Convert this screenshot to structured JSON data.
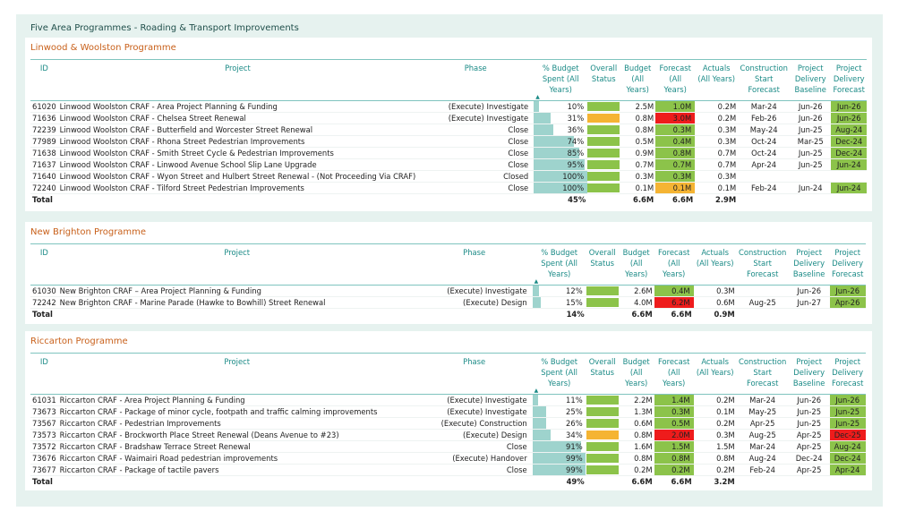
{
  "page_title": "Five Area Programmes - Roading & Transport Improvements",
  "colors": {
    "green": "#8cc34a",
    "amber": "#f5b433",
    "red": "#ee1c1c",
    "header_text": "#1a8a86",
    "section_title": "#c8601a",
    "background": "#e6f2ef"
  },
  "columns": {
    "id": "ID",
    "project": "Project",
    "phase": "Phase",
    "pct_budget": "% Budget Spent (All Years)",
    "overall_status": "Overall Status",
    "budget": "Budget (All Years)",
    "forecast": "Forecast (All Years)",
    "actuals": "Actuals (All Years)",
    "construction_start": "Construction Start Forecast",
    "delivery_baseline": "Project Delivery Baseline",
    "delivery_forecast": "Project Delivery Forecast"
  },
  "sort_icon": "triangle-up",
  "sections": [
    {
      "title": "Linwood & Woolston Programme",
      "rows": [
        {
          "id": "61020",
          "project": "Linwood Woolston CRAF - Area Project Planning & Funding",
          "phase": "(Execute) Investigate",
          "pct": "10%",
          "pct_value": 10,
          "status": "green",
          "budget": "2.5M",
          "forecast": "1.0M",
          "forecast_color": "green",
          "actuals": "0.2M",
          "construction_start": "Mar-24",
          "delivery_baseline": "Jun-26",
          "delivery_forecast": "Jun-26",
          "delivery_color": "green"
        },
        {
          "id": "71636",
          "project": "Linwood Woolston CRAF - Chelsea Street Renewal",
          "phase": "(Execute) Investigate",
          "pct": "31%",
          "pct_value": 31,
          "status": "amber",
          "budget": "0.8M",
          "forecast": "3.0M",
          "forecast_color": "red",
          "actuals": "0.2M",
          "construction_start": "Feb-26",
          "delivery_baseline": "Jun-26",
          "delivery_forecast": "Jun-26",
          "delivery_color": "green"
        },
        {
          "id": "72239",
          "project": "Linwood Woolston CRAF - Butterfield and Worcester Street Renewal",
          "phase": "Close",
          "pct": "36%",
          "pct_value": 36,
          "status": "green",
          "budget": "0.8M",
          "forecast": "0.3M",
          "forecast_color": "green",
          "actuals": "0.3M",
          "construction_start": "May-24",
          "delivery_baseline": "Jun-25",
          "delivery_forecast": "Aug-24",
          "delivery_color": "green"
        },
        {
          "id": "77989",
          "project": "Linwood Woolston CRAF - Rhona Street Pedestrian Improvements",
          "phase": "Close",
          "pct": "74%",
          "pct_value": 74,
          "status": "green",
          "budget": "0.5M",
          "forecast": "0.4M",
          "forecast_color": "green",
          "actuals": "0.3M",
          "construction_start": "Oct-24",
          "delivery_baseline": "Mar-25",
          "delivery_forecast": "Dec-24",
          "delivery_color": "green"
        },
        {
          "id": "71638",
          "project": "Linwood Woolston CRAF - Smith Street Cycle & Pedestrian Improvements",
          "phase": "Close",
          "pct": "85%",
          "pct_value": 85,
          "status": "green",
          "budget": "0.9M",
          "forecast": "0.8M",
          "forecast_color": "green",
          "actuals": "0.7M",
          "construction_start": "Oct-24",
          "delivery_baseline": "Jun-25",
          "delivery_forecast": "Dec-24",
          "delivery_color": "green"
        },
        {
          "id": "71637",
          "project": "Linwood Woolston CRAF - Linwood Avenue School Slip Lane Upgrade",
          "phase": "Close",
          "pct": "95%",
          "pct_value": 95,
          "status": "green",
          "budget": "0.7M",
          "forecast": "0.7M",
          "forecast_color": "green",
          "actuals": "0.7M",
          "construction_start": "Apr-24",
          "delivery_baseline": "Jun-25",
          "delivery_forecast": "Jun-24",
          "delivery_color": "green"
        },
        {
          "id": "71640",
          "project": "Linwood Woolston CRAF - Wyon Street and Hulbert Street Renewal - (Not Proceeding Via CRAF)",
          "phase": "Closed",
          "pct": "100%",
          "pct_value": 100,
          "status": "green",
          "budget": "0.3M",
          "forecast": "0.3M",
          "forecast_color": "green",
          "actuals": "0.3M",
          "construction_start": "",
          "delivery_baseline": "",
          "delivery_forecast": "",
          "delivery_color": "none"
        },
        {
          "id": "72240",
          "project": "Linwood Woolston CRAF - Tilford Street Pedestrian Improvements",
          "phase": "Close",
          "pct": "100%",
          "pct_value": 100,
          "status": "green",
          "budget": "0.1M",
          "forecast": "0.1M",
          "forecast_color": "amber",
          "actuals": "0.1M",
          "construction_start": "Feb-24",
          "delivery_baseline": "Jun-24",
          "delivery_forecast": "Jun-24",
          "delivery_color": "green"
        }
      ],
      "total": {
        "label": "Total",
        "pct": "45%",
        "budget": "6.6M",
        "forecast": "6.6M",
        "actuals": "2.9M"
      }
    },
    {
      "title": "New Brighton Programme",
      "rows": [
        {
          "id": "61030",
          "project": "New Brighton CRAF – Area Project Planning & Funding",
          "phase": "(Execute) Investigate",
          "pct": "12%",
          "pct_value": 12,
          "status": "green",
          "budget": "2.6M",
          "forecast": "0.4M",
          "forecast_color": "green",
          "actuals": "0.3M",
          "construction_start": "",
          "delivery_baseline": "Jun-26",
          "delivery_forecast": "Jun-26",
          "delivery_color": "green"
        },
        {
          "id": "72242",
          "project": "New Brighton CRAF - Marine Parade (Hawke to Bowhill) Street Renewal",
          "phase": "(Execute) Design",
          "pct": "15%",
          "pct_value": 15,
          "status": "green",
          "budget": "4.0M",
          "forecast": "6.2M",
          "forecast_color": "red",
          "actuals": "0.6M",
          "construction_start": "Aug-25",
          "delivery_baseline": "Jun-27",
          "delivery_forecast": "Apr-26",
          "delivery_color": "green"
        }
      ],
      "total": {
        "label": "Total",
        "pct": "14%",
        "budget": "6.6M",
        "forecast": "6.6M",
        "actuals": "0.9M"
      }
    },
    {
      "title": "Riccarton Programme",
      "rows": [
        {
          "id": "61031",
          "project": "Riccarton CRAF - Area Project Planning & Funding",
          "phase": "(Execute) Investigate",
          "pct": "11%",
          "pct_value": 11,
          "status": "green",
          "budget": "2.2M",
          "forecast": "1.4M",
          "forecast_color": "green",
          "actuals": "0.2M",
          "construction_start": "Mar-24",
          "delivery_baseline": "Jun-26",
          "delivery_forecast": "Jun-26",
          "delivery_color": "green"
        },
        {
          "id": "73673",
          "project": "Riccarton CRAF - Package of minor cycle, footpath and traffic calming improvements",
          "phase": "(Execute) Investigate",
          "pct": "25%",
          "pct_value": 25,
          "status": "green",
          "budget": "1.3M",
          "forecast": "0.3M",
          "forecast_color": "green",
          "actuals": "0.1M",
          "construction_start": "May-25",
          "delivery_baseline": "Jun-25",
          "delivery_forecast": "Jun-25",
          "delivery_color": "green"
        },
        {
          "id": "73567",
          "project": "Riccarton CRAF - Pedestrian Improvements",
          "phase": "(Execute) Construction",
          "pct": "26%",
          "pct_value": 26,
          "status": "green",
          "budget": "0.6M",
          "forecast": "0.5M",
          "forecast_color": "green",
          "actuals": "0.2M",
          "construction_start": "Apr-25",
          "delivery_baseline": "Jun-25",
          "delivery_forecast": "Jun-25",
          "delivery_color": "green"
        },
        {
          "id": "73573",
          "project": "Riccarton CRAF - Brockworth Place Street Renewal (Deans Avenue to #23)",
          "phase": "(Execute) Design",
          "pct": "34%",
          "pct_value": 34,
          "status": "amber",
          "budget": "0.8M",
          "forecast": "2.0M",
          "forecast_color": "red",
          "actuals": "0.3M",
          "construction_start": "Aug-25",
          "delivery_baseline": "Apr-25",
          "delivery_forecast": "Dec-25",
          "delivery_color": "red"
        },
        {
          "id": "73572",
          "project": "Riccarton CRAF - Bradshaw Terrace Street Renewal",
          "phase": "Close",
          "pct": "91%",
          "pct_value": 91,
          "status": "green",
          "budget": "1.6M",
          "forecast": "1.5M",
          "forecast_color": "green",
          "actuals": "1.5M",
          "construction_start": "Mar-24",
          "delivery_baseline": "Apr-25",
          "delivery_forecast": "Aug-24",
          "delivery_color": "green"
        },
        {
          "id": "73676",
          "project": "Riccarton CRAF - Waimairi Road pedestrian improvements",
          "phase": "(Execute) Handover",
          "pct": "99%",
          "pct_value": 99,
          "status": "green",
          "budget": "0.8M",
          "forecast": "0.8M",
          "forecast_color": "green",
          "actuals": "0.8M",
          "construction_start": "Aug-24",
          "delivery_baseline": "Dec-24",
          "delivery_forecast": "Dec-24",
          "delivery_color": "green"
        },
        {
          "id": "73677",
          "project": "Riccarton CRAF - Package of tactile pavers",
          "phase": "Close",
          "pct": "99%",
          "pct_value": 99,
          "status": "green",
          "budget": "0.2M",
          "forecast": "0.2M",
          "forecast_color": "green",
          "actuals": "0.2M",
          "construction_start": "Feb-24",
          "delivery_baseline": "Apr-25",
          "delivery_forecast": "Apr-24",
          "delivery_color": "green"
        }
      ],
      "total": {
        "label": "Total",
        "pct": "49%",
        "budget": "6.6M",
        "forecast": "6.6M",
        "actuals": "3.2M"
      }
    }
  ]
}
